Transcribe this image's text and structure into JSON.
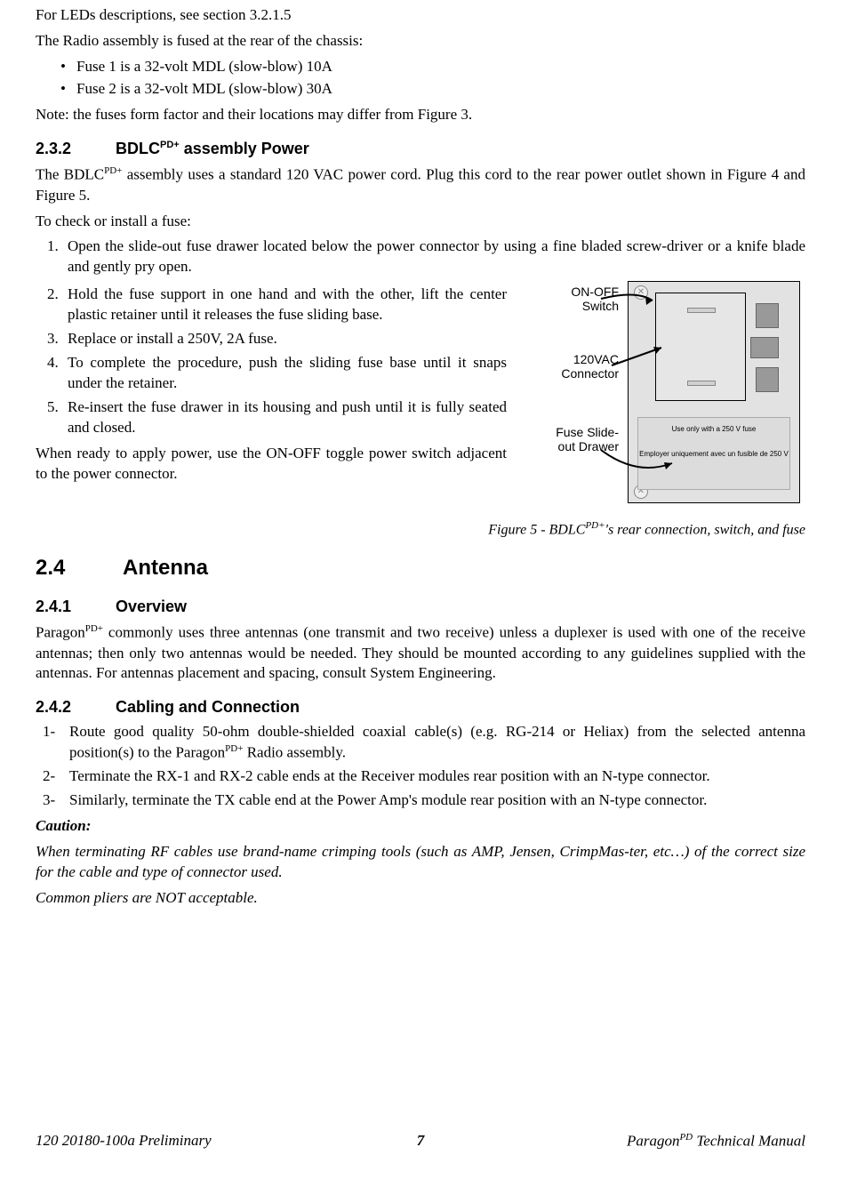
{
  "intro": {
    "leds_ref": "For LEDs descriptions, see section 3.2.1.5",
    "radio_fused": "The Radio assembly is fused at the rear of the chassis:",
    "fuse1": "Fuse 1 is a 32-volt MDL (slow-blow) 10A",
    "fuse2": "Fuse 2 is a 32-volt MDL (slow-blow) 30A",
    "note": "Note: the fuses form factor and their locations may differ from Figure 3."
  },
  "sec232": {
    "num": "2.3.2",
    "title_pre": "BDLC",
    "title_sup": "PD+",
    "title_post": " assembly Power",
    "p1_pre": "The BDLC",
    "p1_sup": "PD+",
    "p1_post": " assembly uses a standard 120 VAC power cord. Plug this cord to the rear power outlet shown in Figure 4 and Figure 5.",
    "check": "To check or install a fuse:",
    "steps": [
      "Open the slide-out fuse drawer located below the power connector by using a fine bladed screw-driver or a knife blade and gently pry open.",
      "Hold the fuse support in one hand and with the other, lift the center plastic retainer until it releases the fuse sliding base.",
      "Replace or install a 250V, 2A fuse.",
      "To complete the procedure, push the sliding fuse base until it snaps under the retainer.",
      "Re-insert the fuse drawer in its housing and push until it is fully seated and closed."
    ],
    "ready": "When ready to apply power, use the ON-OFF toggle power switch adjacent to the power connector."
  },
  "figure5": {
    "label_onoff": "ON-OFF Switch",
    "label_120vac": "120VAC Connector",
    "label_fuse": "Fuse Slide-out Drawer",
    "fuse_en": "Use only with a 250 V fuse",
    "fuse_fr": "Employer uniquement avec un fusible de 250 V",
    "caption_pre": "Figure 5 - BDLC",
    "caption_sup": "PD+",
    "caption_post": "'s rear connection, switch, and fuse"
  },
  "sec24": {
    "num": "2.4",
    "title": "Antenna"
  },
  "sec241": {
    "num": "2.4.1",
    "title": "Overview",
    "p1_pre": "Paragon",
    "p1_sup": "PD+",
    "p1_post": " commonly uses three antennas (one transmit and two receive) unless a duplexer is used with one of the receive antennas; then only two antennas would be needed. They should be mounted according to any guidelines supplied with the antennas. For antennas placement and spacing, consult System Engineering."
  },
  "sec242": {
    "num": "2.4.2",
    "title": "Cabling and Connection",
    "steps": {
      "s1_pre": "Route good quality 50-ohm double-shielded coaxial cable(s) (e.g. RG-214 or Heliax) from the selected antenna position(s) to the Paragon",
      "s1_sup": "PD+",
      "s1_post": " Radio assembly.",
      "s2": "Terminate the RX-1 and RX-2 cable ends at the Receiver modules rear position with an N-type connector.",
      "s3": "Similarly, terminate the TX cable end at the Power Amp's module rear position with an N-type connector."
    },
    "caution_label": "Caution:",
    "caution1": "When terminating RF cables use brand-name crimping tools (such as AMP, Jensen, CrimpMas-ter, etc…) of the correct size for the cable and type of connector used.",
    "caution2": "Common pliers are NOT acceptable."
  },
  "footer": {
    "left": "120 20180-100a Preliminary",
    "center": "7",
    "right_pre": "Paragon",
    "right_sup": "PD",
    "right_post": " Technical Manual"
  }
}
